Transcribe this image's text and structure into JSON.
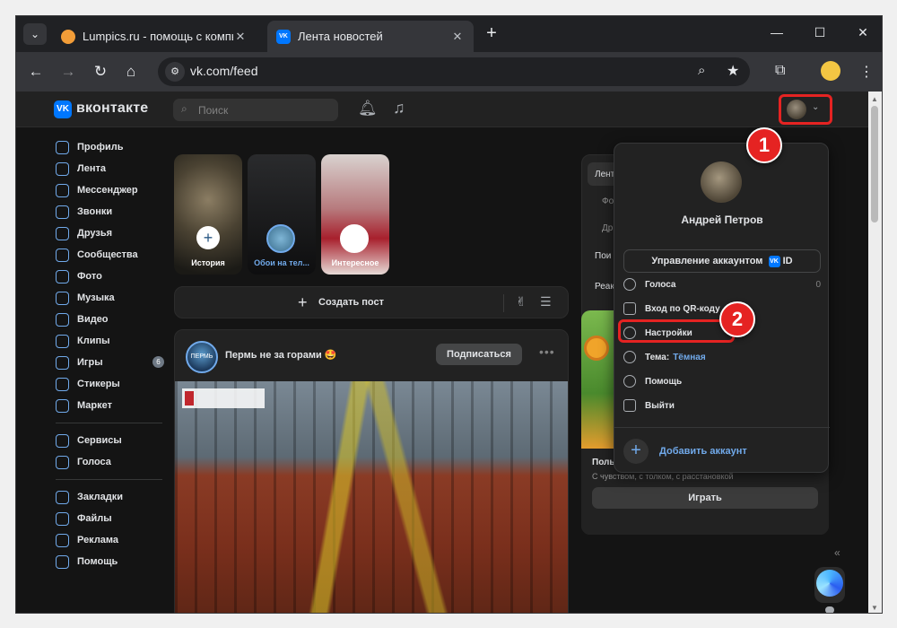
{
  "browser": {
    "tabs": [
      {
        "title": "Lumpics.ru - помощь с компью",
        "favicon": "orange-circle-icon"
      },
      {
        "title": "Лента новостей",
        "favicon": "vk-icon"
      }
    ],
    "url": "vk.com/feed"
  },
  "vk": {
    "logo_text": "вконтакте",
    "search_placeholder": "Поиск",
    "nav": [
      {
        "label": "Профиль",
        "icon": "profile-icon"
      },
      {
        "label": "Лента",
        "icon": "feed-icon"
      },
      {
        "label": "Мессенджер",
        "icon": "messenger-icon"
      },
      {
        "label": "Звонки",
        "icon": "calls-icon"
      },
      {
        "label": "Друзья",
        "icon": "friends-icon"
      },
      {
        "label": "Сообщества",
        "icon": "communities-icon"
      },
      {
        "label": "Фото",
        "icon": "photo-icon"
      },
      {
        "label": "Музыка",
        "icon": "music-icon"
      },
      {
        "label": "Видео",
        "icon": "video-icon"
      },
      {
        "label": "Клипы",
        "icon": "clips-icon"
      },
      {
        "label": "Игры",
        "icon": "games-icon",
        "badge": "6"
      },
      {
        "label": "Стикеры",
        "icon": "stickers-icon"
      },
      {
        "label": "Маркет",
        "icon": "market-icon"
      },
      {
        "label": "Сервисы",
        "icon": "services-icon"
      },
      {
        "label": "Голоса",
        "icon": "votes-icon"
      },
      {
        "label": "Закладки",
        "icon": "bookmarks-icon"
      },
      {
        "label": "Файлы",
        "icon": "files-icon"
      },
      {
        "label": "Реклама",
        "icon": "ads-icon"
      },
      {
        "label": "Помощь",
        "icon": "help-icon"
      }
    ],
    "stories": [
      {
        "label": "История"
      },
      {
        "label": "Обои на тел..."
      },
      {
        "label": "Интересное"
      }
    ],
    "create_post": "Создать пост",
    "post": {
      "author": "Пермь не за горами 🤩",
      "avatar_text": "ПЕРМЬ",
      "subscribe": "Подписаться"
    },
    "right_menu": {
      "items": [
        "Лент",
        "Фо",
        "Др",
        "Пои",
        "Реак"
      ]
    },
    "game": {
      "title": "Пользо...",
      "description": "С чувством, с толком, с расстановкой",
      "play": "Играть"
    },
    "dropdown": {
      "name": "Андрей Петров",
      "manage": "Управление аккаунтом",
      "manage_id": "ID",
      "items": [
        {
          "label": "Голоса",
          "count": "0"
        },
        {
          "label": "Вход по QR-коду"
        },
        {
          "label": "Настройки"
        },
        {
          "label": "Тема:",
          "value": "Тёмная"
        },
        {
          "label": "Помощь"
        },
        {
          "label": "Выйти"
        }
      ],
      "add_account": "Добавить аккаунт"
    },
    "callouts": [
      "1",
      "2"
    ]
  }
}
